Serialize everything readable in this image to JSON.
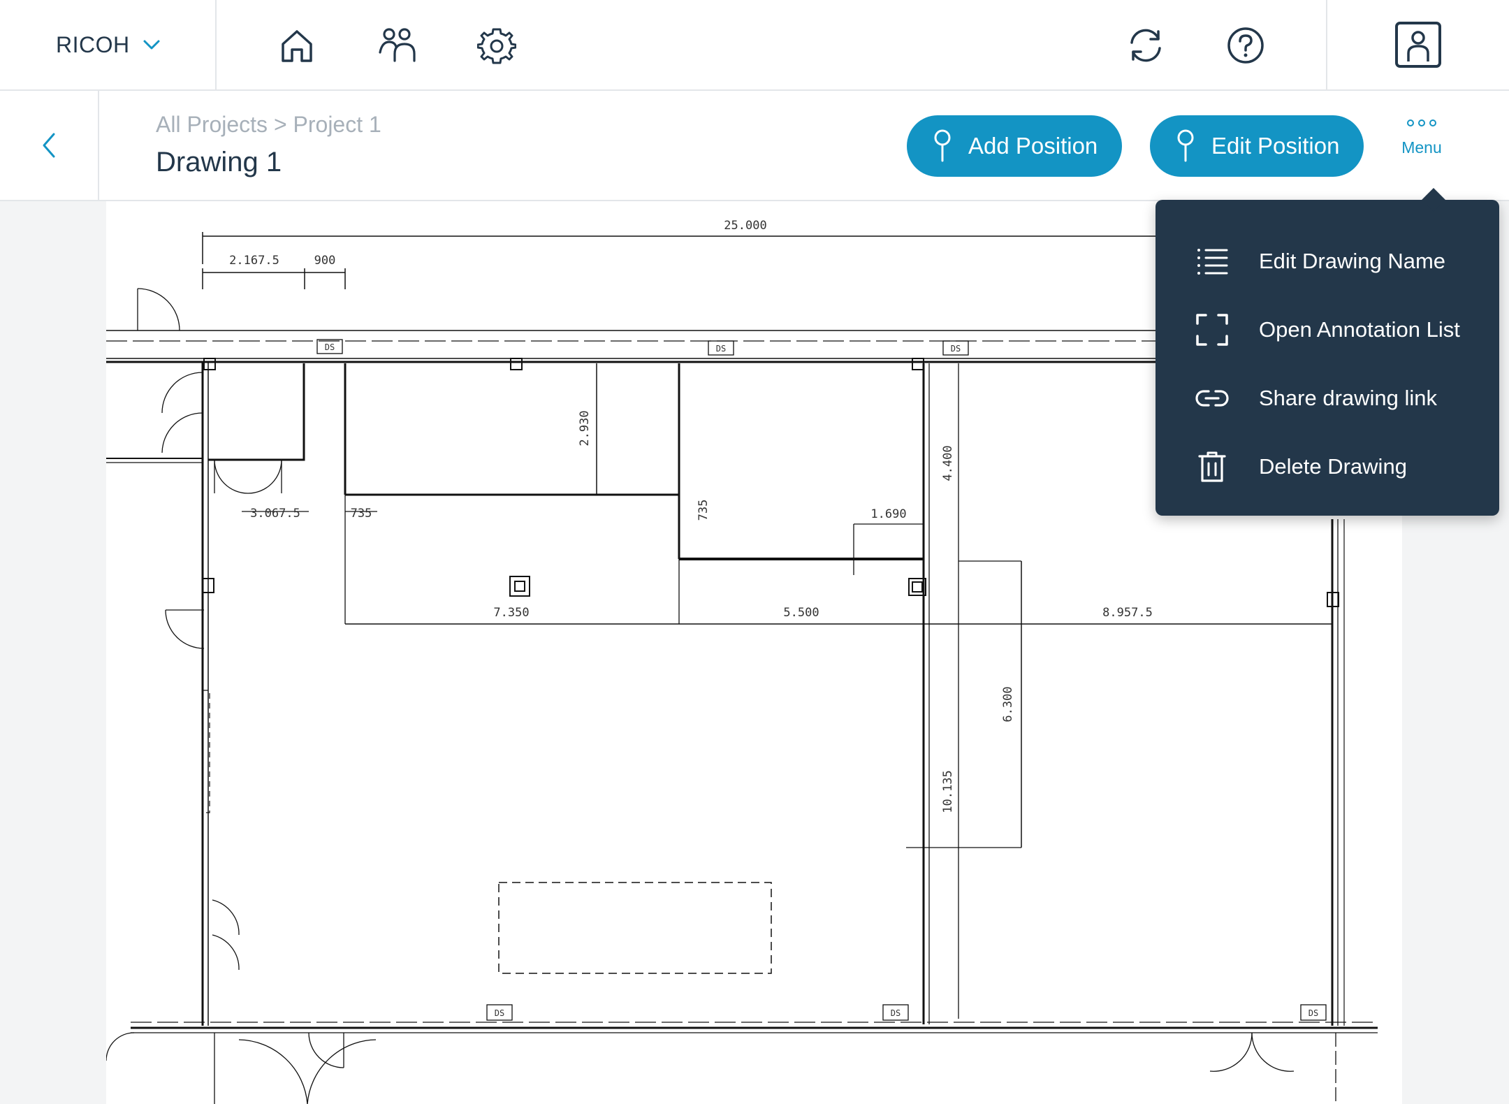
{
  "topbar": {
    "brand": "RICOH",
    "icons": [
      "home-icon",
      "users-icon",
      "settings-icon",
      "sync-icon",
      "help-icon",
      "user-account-icon"
    ]
  },
  "header": {
    "breadcrumb": {
      "root": "All Projects",
      "separator": ">",
      "project": "Project 1"
    },
    "title": "Drawing 1",
    "add_position_label": "Add Position",
    "edit_position_label": "Edit Position",
    "menu_label": "Menu"
  },
  "menu": {
    "items": [
      {
        "label": "Edit Drawing Name",
        "icon": "list-icon"
      },
      {
        "label": "Open Annotation List",
        "icon": "frame-icon"
      },
      {
        "label": "Share drawing link",
        "icon": "link-icon"
      },
      {
        "label": "Delete Drawing",
        "icon": "trash-icon"
      }
    ]
  },
  "drawing": {
    "dimensions": {
      "overall_width": "25.000",
      "d1": "2.167.5",
      "d2": "900",
      "d3": "3.067.5",
      "d4": "735",
      "d5": "2.930",
      "d6": "735",
      "d7": "1.690",
      "d8": "4.400",
      "d9": "7.350",
      "d10": "5.500",
      "d11": "8.957.5",
      "d12": "6.300",
      "d13": "10.135"
    },
    "tag": "DS"
  },
  "colors": {
    "accent": "#1394c4",
    "navy": "#23374a",
    "border": "#e3e6e9",
    "muted": "#a7b0b9"
  }
}
